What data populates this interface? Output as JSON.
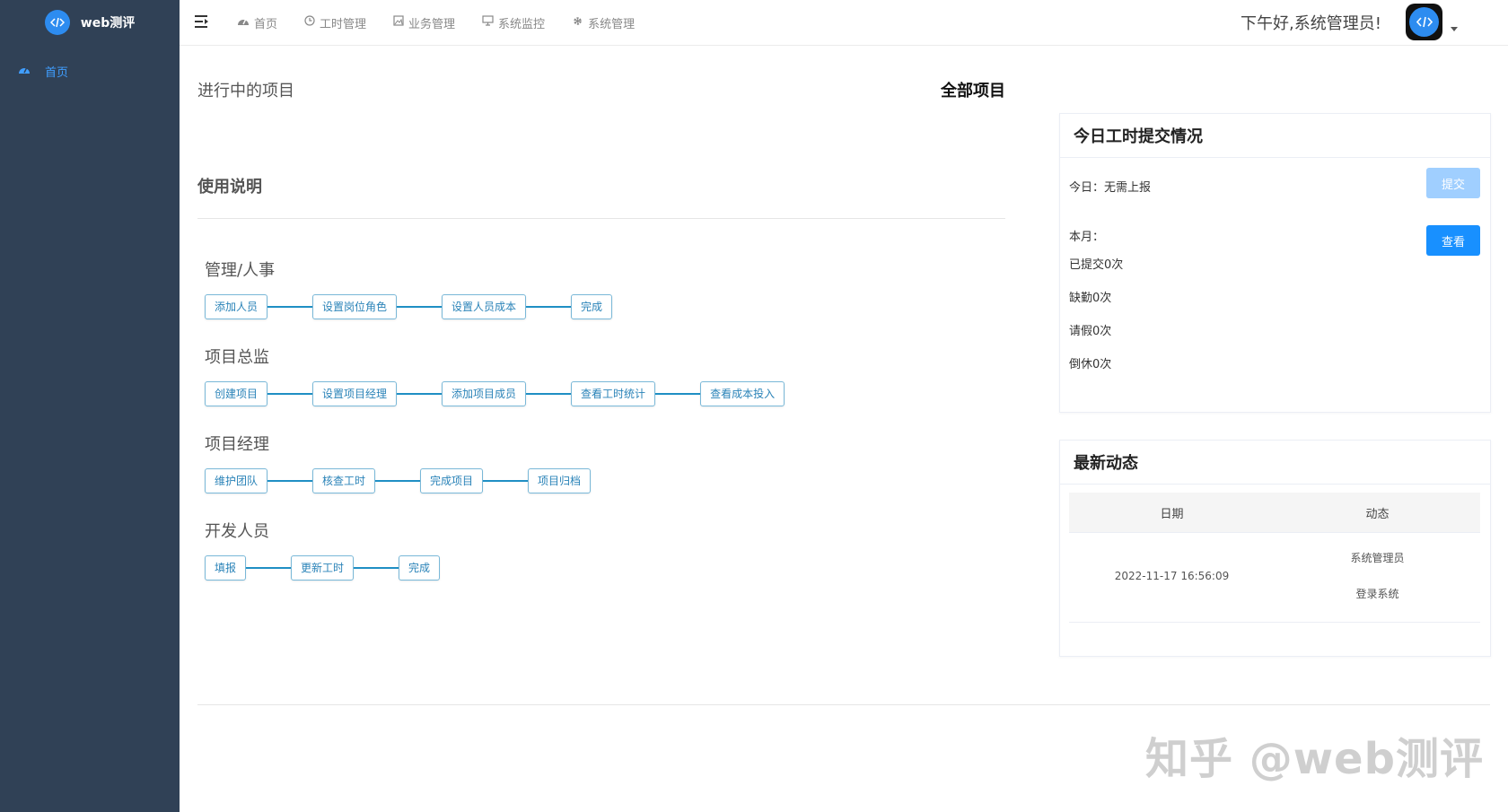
{
  "app": {
    "title": "web测评"
  },
  "sidebar": {
    "items": [
      {
        "label": "首页",
        "icon": "dashboard-icon"
      }
    ]
  },
  "header": {
    "nav": [
      {
        "label": "首页",
        "icon": "dashboard-icon"
      },
      {
        "label": "工时管理",
        "icon": "clock-icon"
      },
      {
        "label": "业务管理",
        "icon": "image-icon"
      },
      {
        "label": "系统监控",
        "icon": "monitor-icon"
      },
      {
        "label": "系统管理",
        "icon": "gear-icon"
      }
    ],
    "greeting": "下午好,系统管理员!"
  },
  "main": {
    "in_progress_title": "进行中的项目",
    "all_projects": "全部项目",
    "usage_title": "使用说明",
    "flows": [
      {
        "title": "管理/人事",
        "steps": [
          "添加人员",
          "设置岗位角色",
          "设置人员成本",
          "完成"
        ]
      },
      {
        "title": "项目总监",
        "steps": [
          "创建项目",
          "设置项目经理",
          "添加项目成员",
          "查看工时统计",
          "查看成本投入"
        ]
      },
      {
        "title": "项目经理",
        "steps": [
          "维护团队",
          "核查工时",
          "完成项目",
          "项目归档"
        ]
      },
      {
        "title": "开发人员",
        "steps": [
          "填报",
          "更新工时",
          "完成"
        ]
      }
    ]
  },
  "worklog_card": {
    "title": "今日工时提交情况",
    "today": "今日：无需上报",
    "submit_label": "提交",
    "month": "本月：",
    "view_label": "查看",
    "submitted": "已提交0次",
    "absent": "缺勤0次",
    "leave": "请假0次",
    "off": "倒休0次"
  },
  "news_card": {
    "title": "最新动态",
    "columns": [
      "日期",
      "动态"
    ],
    "rows": [
      {
        "date": "2022-11-17 16:56:09",
        "user": "系统管理员",
        "action": "登录系统"
      }
    ]
  },
  "watermark": "知乎 @web测评",
  "colors": {
    "sidebar": "#304156",
    "primary": "#1890ff",
    "primary_disabled": "#a0cfff",
    "flow_line": "#1f8fc4"
  }
}
